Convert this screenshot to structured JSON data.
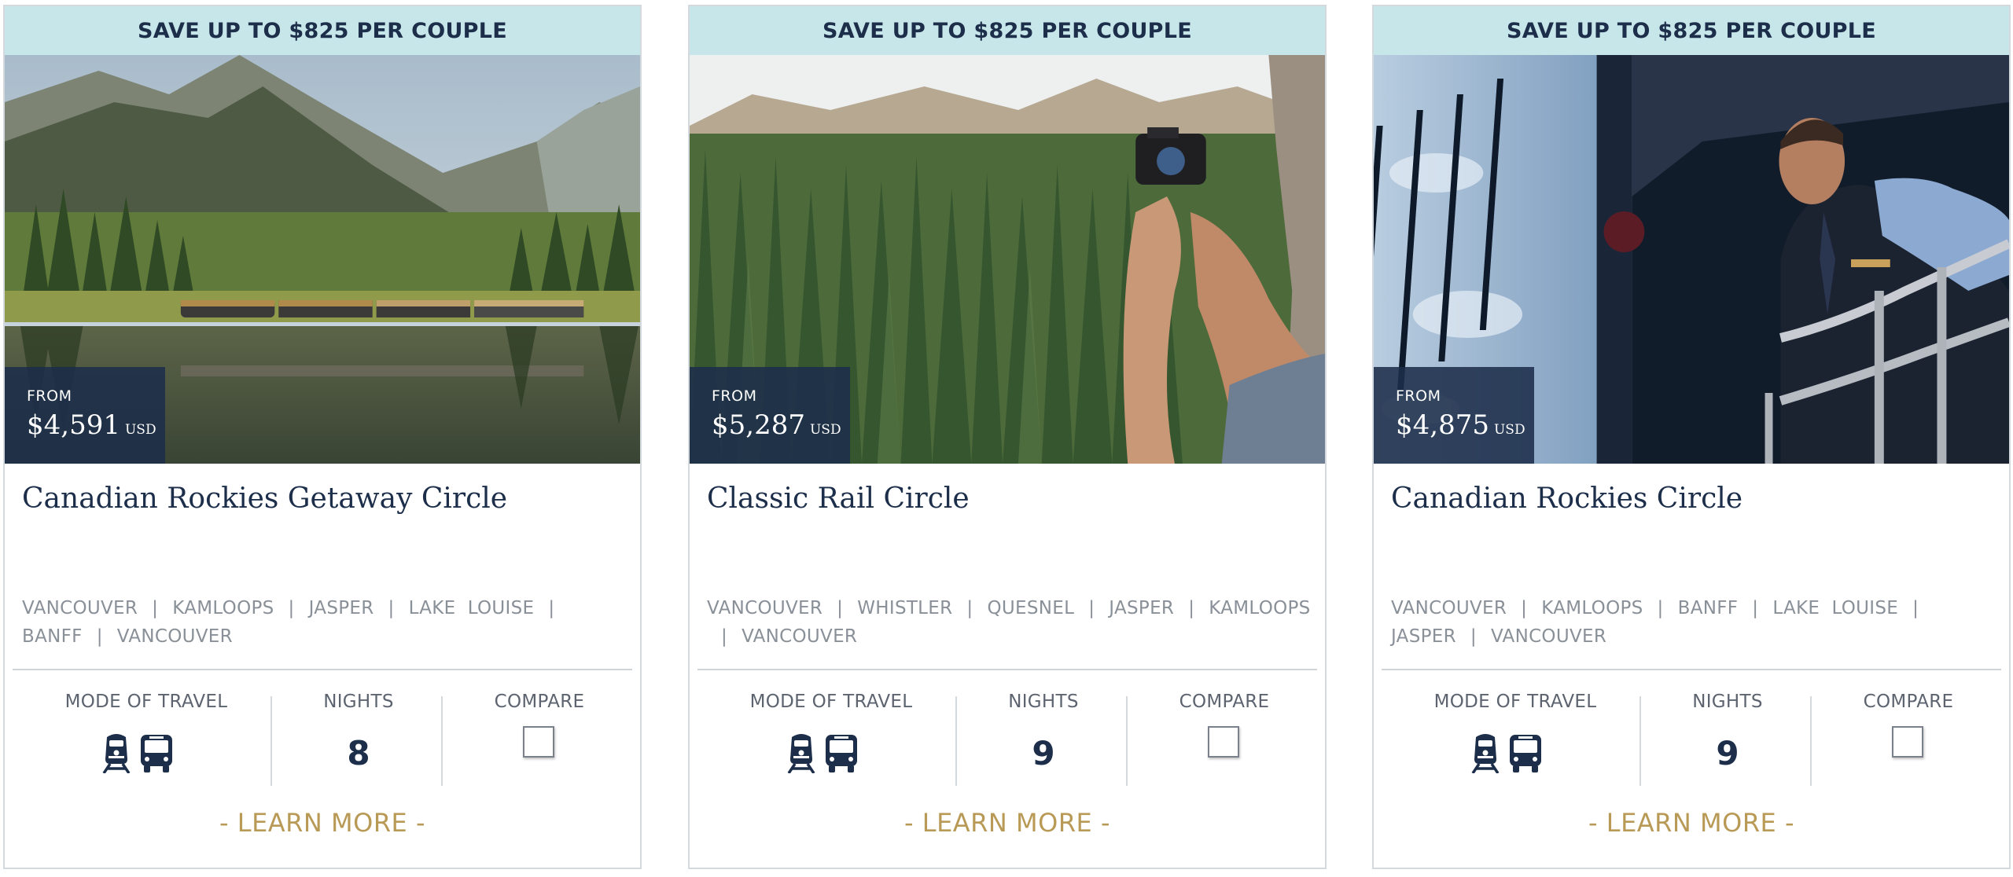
{
  "cards": [
    {
      "banner": "SAVE UP TO $825 PER COUPLE",
      "price_from_label": "FROM",
      "price": "$4,591",
      "currency": "USD",
      "title": "Canadian Rockies Getaway Circle",
      "route": [
        "VANCOUVER",
        "KAMLOOPS",
        "JASPER",
        "LAKE  LOUISE",
        "BANFF",
        "VANCOUVER"
      ],
      "mode_label": "MODE OF TRAVEL",
      "mode_icons": [
        "train-icon",
        "bus-icon"
      ],
      "nights_label": "NIGHTS",
      "nights": "8",
      "compare_label": "COMPARE",
      "learn_more": "- LEARN MORE -"
    },
    {
      "banner": "SAVE UP TO $825 PER COUPLE",
      "price_from_label": "FROM",
      "price": "$5,287",
      "currency": "USD",
      "title": "Classic Rail Circle",
      "route": [
        "VANCOUVER",
        "WHISTLER",
        "QUESNEL",
        "JASPER",
        "KAMLOOPS",
        "VANCOUVER"
      ],
      "mode_label": "MODE OF TRAVEL",
      "mode_icons": [
        "train-icon",
        "bus-icon"
      ],
      "nights_label": "NIGHTS",
      "nights": "9",
      "compare_label": "COMPARE",
      "learn_more": "- LEARN MORE -"
    },
    {
      "banner": "SAVE UP TO $825 PER COUPLE",
      "price_from_label": "FROM",
      "price": "$4,875",
      "currency": "USD",
      "title": "Canadian Rockies Circle",
      "route": [
        "VANCOUVER",
        "KAMLOOPS",
        "BANFF",
        "LAKE  LOUISE",
        "JASPER",
        "VANCOUVER"
      ],
      "mode_label": "MODE OF TRAVEL",
      "mode_icons": [
        "train-icon",
        "bus-icon"
      ],
      "nights_label": "NIGHTS",
      "nights": "9",
      "compare_label": "COMPARE",
      "learn_more": "- LEARN MORE -"
    }
  ],
  "colors": {
    "navy": "#1c2e4a",
    "banner_bg": "#c7e6ea",
    "gold": "#b89a56",
    "muted": "#8a9098"
  }
}
